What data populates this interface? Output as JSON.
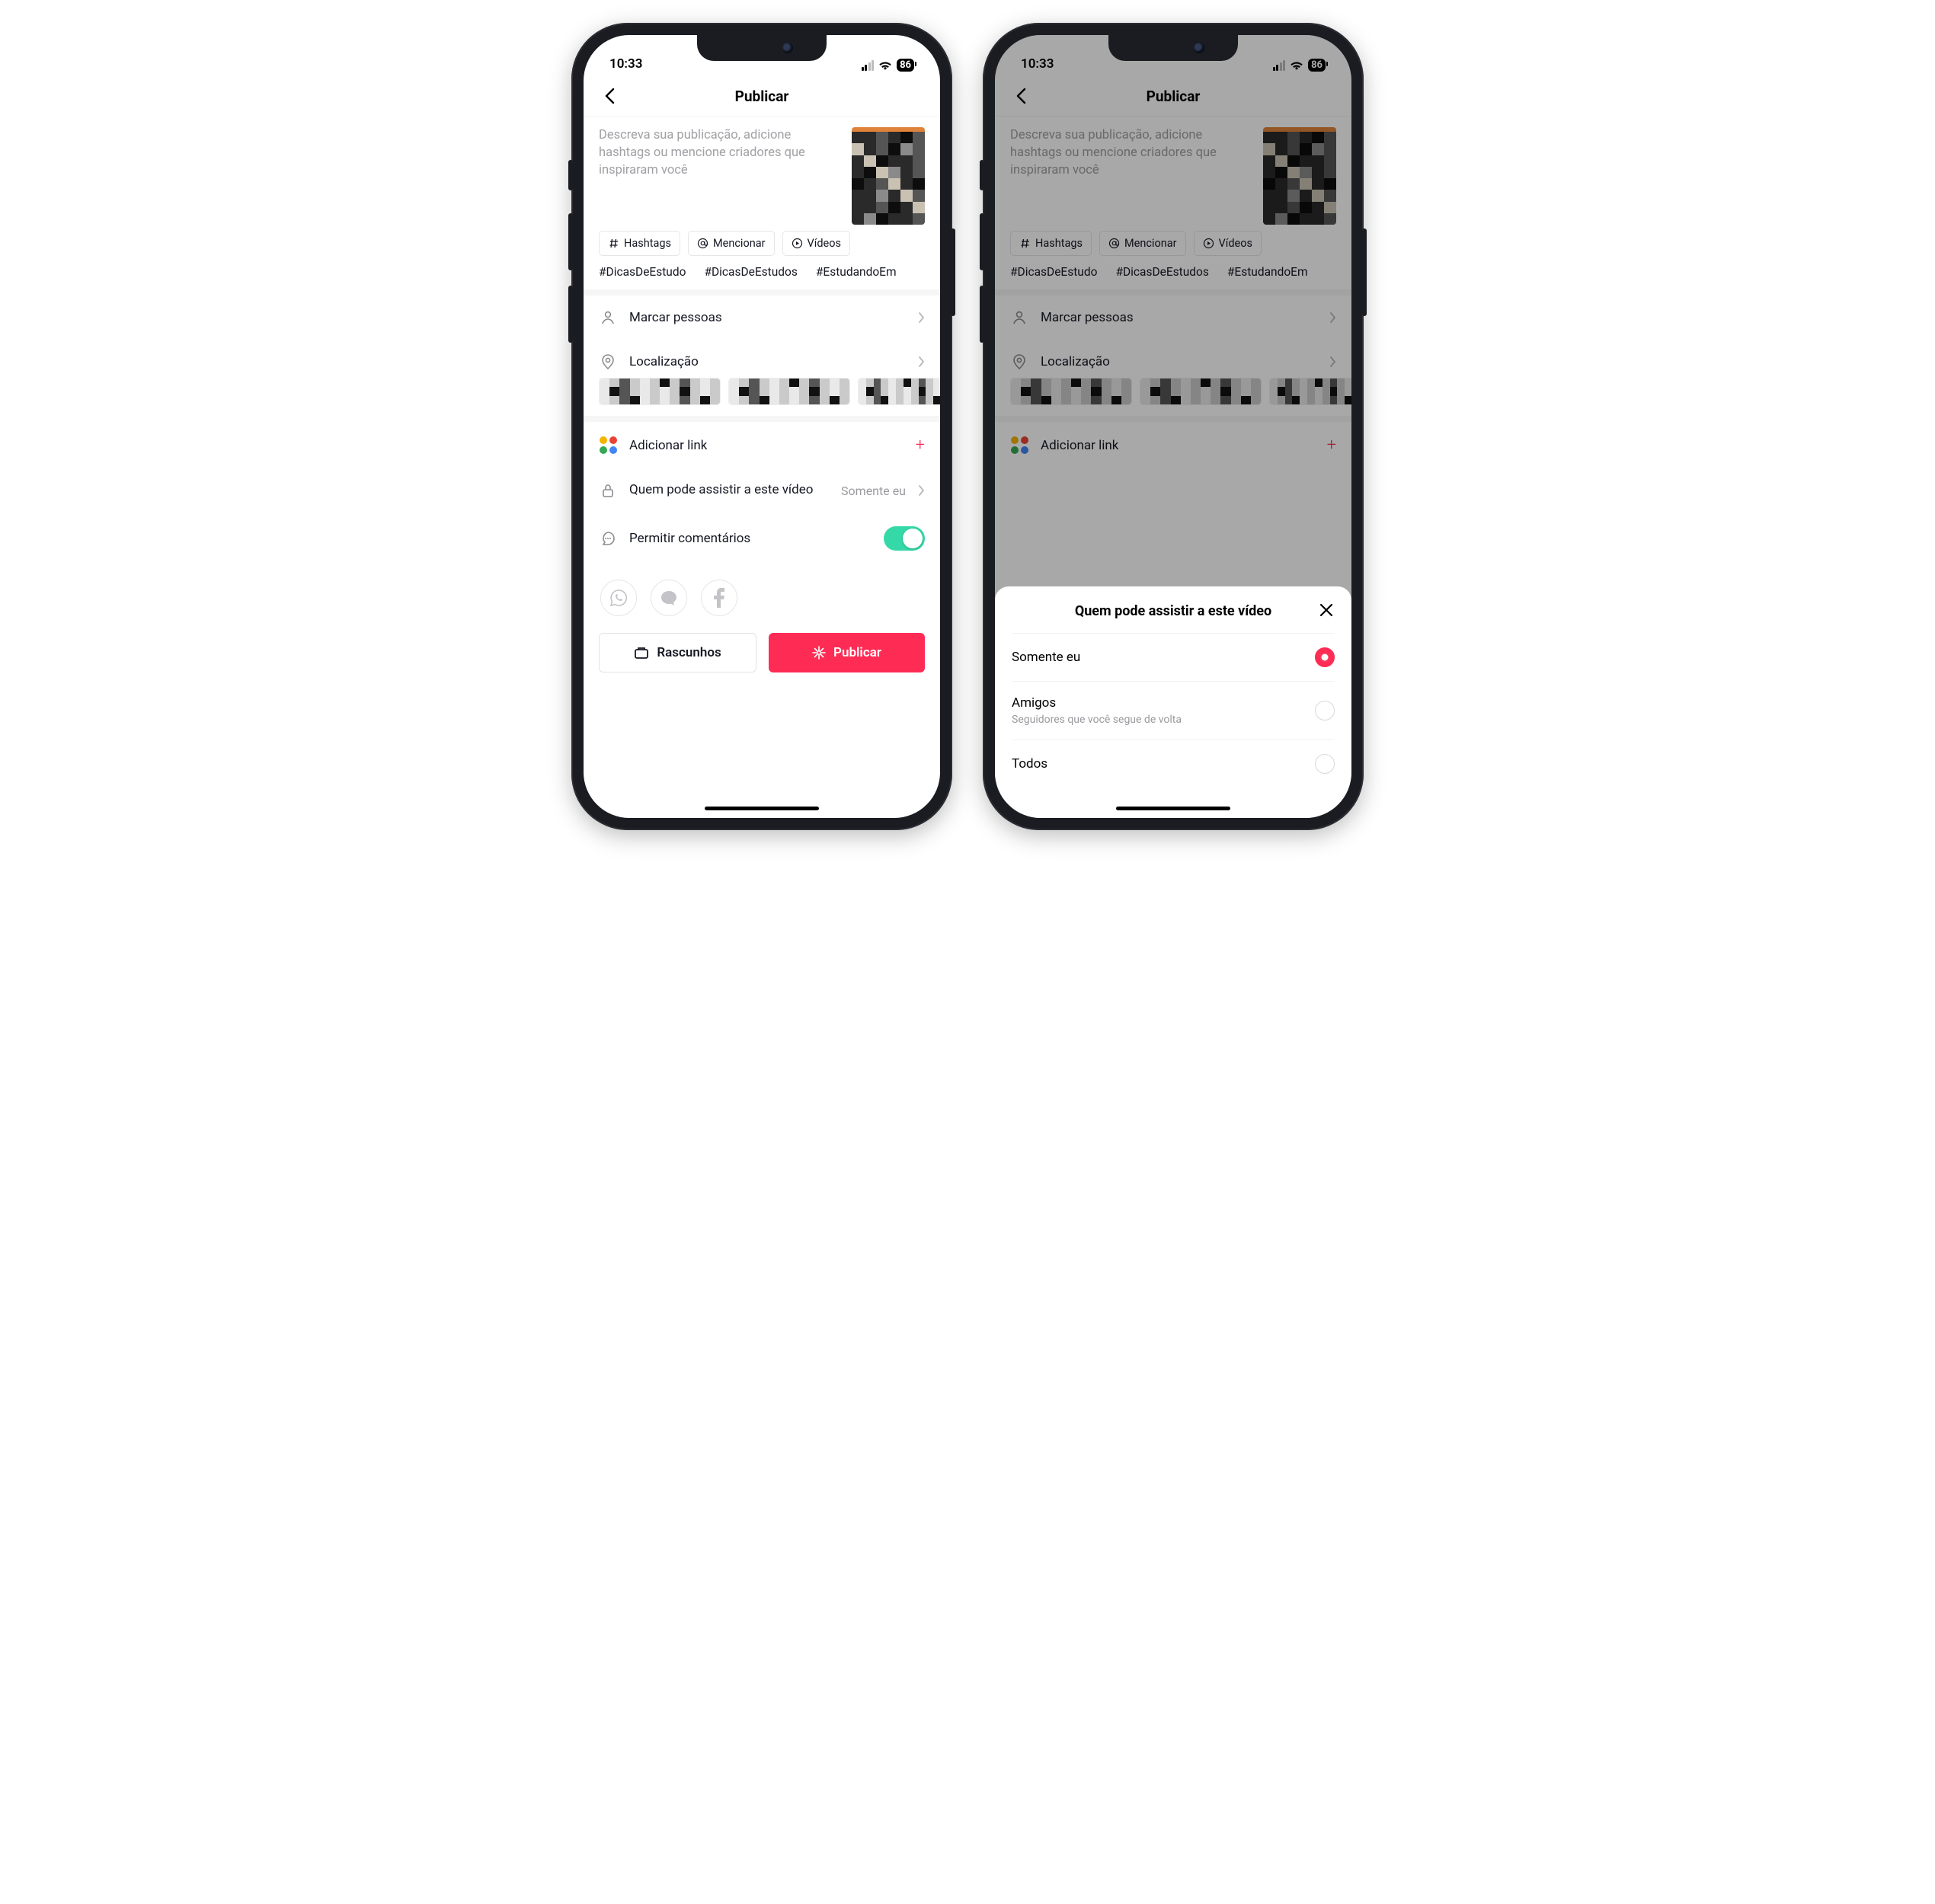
{
  "status": {
    "time": "10:33",
    "battery": "86"
  },
  "header": {
    "title": "Publicar"
  },
  "caption": {
    "placeholder": "Descreva sua publicação, adicione hashtags ou mencione criadores que inspiraram você"
  },
  "chips": {
    "hashtags": "Hashtags",
    "mention": "Mencionar",
    "videos": "Vídeos"
  },
  "hashtag_suggestions": [
    "#DicasDeEstudo",
    "#DicasDeEstudos",
    "#EstudandoEm"
  ],
  "rows": {
    "tag_people": "Marcar pessoas",
    "location": "Localização",
    "add_link": "Adicionar link",
    "privacy_label": "Quem pode assistir a este vídeo",
    "privacy_value": "Somente eu",
    "comments": "Permitir comentários"
  },
  "buttons": {
    "drafts": "Rascunhos",
    "publish": "Publicar"
  },
  "sheet": {
    "title": "Quem pode assistir a este vídeo",
    "options": [
      {
        "label": "Somente eu",
        "sub": "",
        "selected": true
      },
      {
        "label": "Amigos",
        "sub": "Seguidores que você segue de volta",
        "selected": false
      },
      {
        "label": "Todos",
        "sub": "",
        "selected": false
      }
    ]
  }
}
